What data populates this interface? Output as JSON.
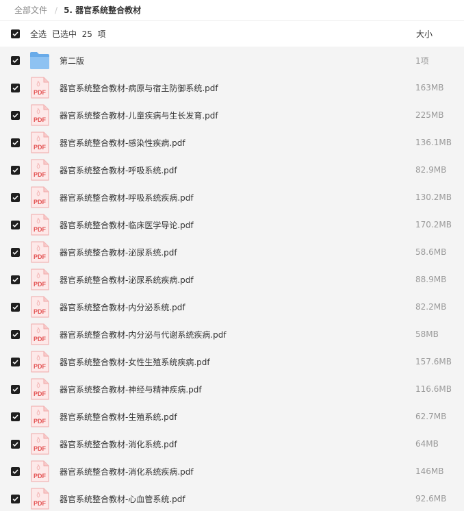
{
  "breadcrumb": {
    "root": "全部文件",
    "separator": "/",
    "current": "5. 器官系统整合教材"
  },
  "header": {
    "select_all": "全选",
    "selected_count": "已选中  25  项",
    "size_column": "大小"
  },
  "colors": {
    "checkbox": "#1f1f1f",
    "pdf_red": "#e35353",
    "folder_blue": "#69abe9"
  },
  "files": [
    {
      "name": "第二版",
      "size": "1项",
      "type": "folder"
    },
    {
      "name": "器官系统整合教材-病原与宿主防御系统.pdf",
      "size": "163MB",
      "type": "pdf"
    },
    {
      "name": "器官系统整合教材-儿童疾病与生长发育.pdf",
      "size": "225MB",
      "type": "pdf"
    },
    {
      "name": "器官系统整合教材-感染性疾病.pdf",
      "size": "136.1MB",
      "type": "pdf"
    },
    {
      "name": "器官系统整合教材-呼吸系统.pdf",
      "size": "82.9MB",
      "type": "pdf"
    },
    {
      "name": "器官系统整合教材-呼吸系统疾病.pdf",
      "size": "130.2MB",
      "type": "pdf"
    },
    {
      "name": "器官系统整合教材-临床医学导论.pdf",
      "size": "170.2MB",
      "type": "pdf"
    },
    {
      "name": "器官系统整合教材-泌尿系统.pdf",
      "size": "58.6MB",
      "type": "pdf"
    },
    {
      "name": "器官系统整合教材-泌尿系统疾病.pdf",
      "size": "88.9MB",
      "type": "pdf"
    },
    {
      "name": "器官系统整合教材-内分泌系统.pdf",
      "size": "82.2MB",
      "type": "pdf"
    },
    {
      "name": "器官系统整合教材-内分泌与代谢系统疾病.pdf",
      "size": "58MB",
      "type": "pdf"
    },
    {
      "name": "器官系统整合教材-女性生殖系统疾病.pdf",
      "size": "157.6MB",
      "type": "pdf"
    },
    {
      "name": "器官系统整合教材-神经与精神疾病.pdf",
      "size": "116.6MB",
      "type": "pdf"
    },
    {
      "name": "器官系统整合教材-生殖系统.pdf",
      "size": "62.7MB",
      "type": "pdf"
    },
    {
      "name": "器官系统整合教材-消化系统.pdf",
      "size": "64MB",
      "type": "pdf"
    },
    {
      "name": "器官系统整合教材-消化系统疾病.pdf",
      "size": "146MB",
      "type": "pdf"
    },
    {
      "name": "器官系统整合教材-心血管系统.pdf",
      "size": "92.6MB",
      "type": "pdf"
    }
  ]
}
